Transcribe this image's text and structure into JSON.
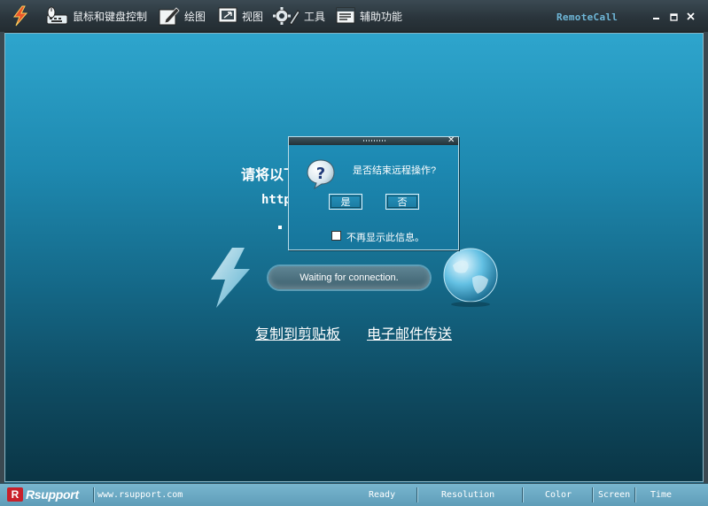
{
  "toolbar": {
    "items": [
      {
        "label": "鼠标和键盘控制",
        "icon": "mouse-keyboard-icon"
      },
      {
        "label": "绘图",
        "icon": "draw-icon"
      },
      {
        "label": "视图",
        "icon": "view-icon"
      },
      {
        "label": "工具",
        "icon": "tools-icon"
      },
      {
        "label": "辅助功能",
        "icon": "assist-icon"
      }
    ],
    "app_icon": "lightning-icon",
    "app_title": "RemoteCall",
    "window_controls": [
      "minimize-icon",
      "maximize-icon",
      "close-icon"
    ]
  },
  "main": {
    "instruction_text": "请将以下",
    "url_text": "http",
    "status_text": "Waiting for connection.",
    "copy_link": "复制到剪贴板",
    "email_link": "电子邮件传送"
  },
  "dialog": {
    "close_symbol": "✕",
    "message": "是否结束远程操作?",
    "yes_label": "是",
    "no_label": "否",
    "checkbox_label": "不再显示此信息。",
    "checkbox_checked": false
  },
  "statusbar": {
    "brand_mark": "R",
    "brand": "Rsupport",
    "website": "www.rsupport.com",
    "ready": "Ready",
    "resolution": "Resolution",
    "color": "Color",
    "screen": "Screen",
    "time": "Time"
  },
  "colors": {
    "accent": "#2ea5cd",
    "toolbar_bg": "#2a353c",
    "brand_red": "#c8202a",
    "title_blue": "#6fb7d8"
  }
}
